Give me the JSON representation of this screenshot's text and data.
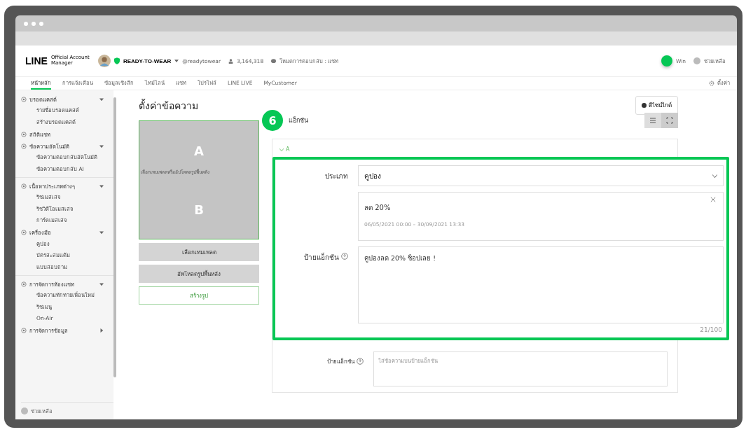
{
  "header": {
    "logo": "LINE",
    "logo_sub": "Official Account Manager",
    "account": "READY-TO-WEAR",
    "account_id": "@readytowear",
    "friends": "3,164,318",
    "chat_mode": "โหมดการตอบกลับ : แชท",
    "user": "Win",
    "help": "ช่วยเหลือ"
  },
  "nav": {
    "items": [
      {
        "label": "หน้าหลัก",
        "selected": true
      },
      {
        "label": "การแจ้งเตือน",
        "selected": false
      },
      {
        "label": "ข้อมูลเชิงลึก",
        "selected": false
      },
      {
        "label": "ไทม์ไลน์",
        "selected": false
      },
      {
        "label": "แชท",
        "selected": false
      },
      {
        "label": "โปรไฟล์",
        "selected": false
      },
      {
        "label": "LINE LIVE",
        "selected": false
      },
      {
        "label": "MyCustomer",
        "selected": false
      }
    ],
    "settings": "ตั้งค่า"
  },
  "sidebar": {
    "groups": [
      {
        "label": "บรอดแคสต์",
        "expanded": true,
        "children": [
          {
            "label": "รายชื่อบรอดแคสต์"
          },
          {
            "label": "สร้างบรอดแคสต์"
          }
        ]
      },
      {
        "label": "สถิติแชท"
      },
      {
        "label": "ข้อความอัตโนมัติ",
        "expanded": true,
        "children": [
          {
            "label": "ข้อความตอบกลับอัตโนมัติ"
          },
          {
            "label": "ข้อความตอบกลับ AI"
          }
        ]
      },
      {
        "label": "เนื้อหาประเภทต่างๆ",
        "expanded": true,
        "divider": true,
        "children": [
          {
            "label": "ริชเมสเสจ"
          },
          {
            "label": "ริชวิดีโอเมสเสจ"
          },
          {
            "label": "การ์ดเมสเสจ"
          }
        ]
      },
      {
        "label": "เครื่องมือ",
        "expanded": true,
        "children": [
          {
            "label": "คูปอง"
          },
          {
            "label": "บัตรสะสมแต้ม"
          },
          {
            "label": "แบบสอบถาม"
          }
        ]
      },
      {
        "label": "การจัดการห้องแชท",
        "expanded": true,
        "divider": true,
        "children": [
          {
            "label": "ข้อความทักทายเพื่อนใหม่"
          },
          {
            "label": "ริชเมนู"
          },
          {
            "label": "On-Air"
          }
        ]
      },
      {
        "label": "การจัดการข้อมูล",
        "expanded": false
      }
    ],
    "footer": "ช่วยเหลือ"
  },
  "page": {
    "title": "ตั้งค่าข้อความ",
    "guide_button": "ดีไซน์ไกด์"
  },
  "preview": {
    "cells": [
      "A",
      "B"
    ],
    "overlay_text": "เลือกเทมเพลตหรืออัปโหลดรูปพื้นหลัง",
    "buttons": [
      {
        "label": "เลือกเทมเพลต",
        "kind": "filled"
      },
      {
        "label": "อัพโหลดรูปพื้นหลัง",
        "kind": "filled"
      },
      {
        "label": "สร้างรูป",
        "kind": "outline"
      }
    ]
  },
  "action": {
    "step": "6",
    "title": "แอ็กชัน",
    "view_toggle": [
      {
        "kind": "list",
        "selected": false
      },
      {
        "kind": "expand",
        "selected": true
      }
    ],
    "section": "A",
    "type_label": "ประเภท",
    "type_value": "คูปอง",
    "coupon": {
      "title": "ลด 20%",
      "period": "06/05/2021 00:00 – 30/09/2021 13:33"
    },
    "label_label": "ป้ายแอ็กชัน",
    "label_value": "คูปองลด 20% ช็อปเลย !",
    "counter": "21/100",
    "next_label": "ป้ายแอ็กชัน",
    "next_placeholder": "ใส่ข้อความบนป้ายแอ็กชัน"
  }
}
